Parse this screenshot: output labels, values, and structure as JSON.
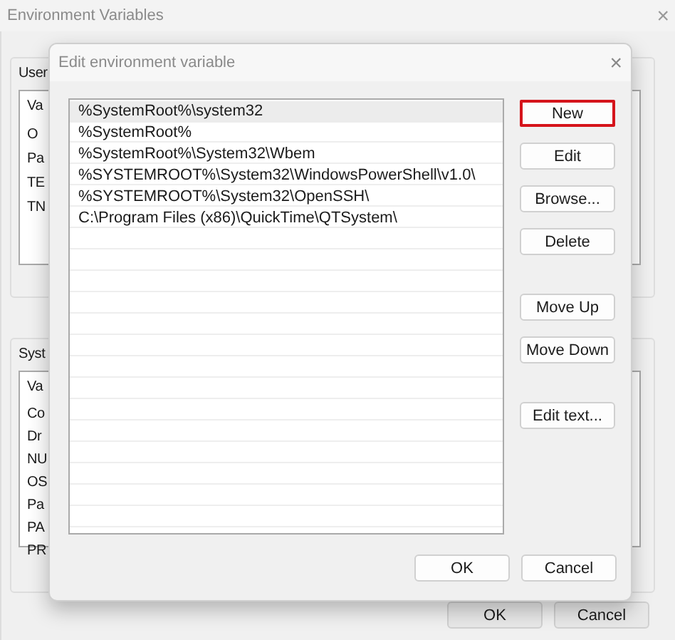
{
  "window": {
    "title": "Environment Variables",
    "close_glyph": "×"
  },
  "user_variables": {
    "label": "User",
    "header": "Va",
    "rows": [
      "O",
      "Pa",
      "TE",
      "TN"
    ]
  },
  "system_variables": {
    "label": "Syst",
    "header": "Va",
    "rows": [
      "Co",
      "Dr",
      "NU",
      "OS",
      "Pa",
      "PA",
      "PR"
    ]
  },
  "window_buttons": [
    "OK",
    "Cancel"
  ],
  "dialog": {
    "title": "Edit environment variable",
    "close_glyph": "×",
    "entries": [
      {
        "text": "%SystemRoot%\\system32",
        "selected": true
      },
      {
        "text": "%SystemRoot%",
        "selected": false
      },
      {
        "text": "%SystemRoot%\\System32\\Wbem",
        "selected": false
      },
      {
        "text": "%SYSTEMROOT%\\System32\\WindowsPowerShell\\v1.0\\",
        "selected": false
      },
      {
        "text": "%SYSTEMROOT%\\System32\\OpenSSH\\",
        "selected": false
      },
      {
        "text": "C:\\Program Files (x86)\\QuickTime\\QTSystem\\",
        "selected": false
      }
    ],
    "side_button_groups": [
      [
        {
          "label": "New",
          "highlighted": true
        },
        {
          "label": "Edit",
          "highlighted": false
        },
        {
          "label": "Browse...",
          "highlighted": false
        },
        {
          "label": "Delete",
          "highlighted": false
        }
      ],
      [
        {
          "label": "Move Up",
          "highlighted": false
        },
        {
          "label": "Move Down",
          "highlighted": false
        }
      ],
      [
        {
          "label": "Edit text...",
          "highlighted": false
        }
      ]
    ],
    "footer_buttons": [
      "OK",
      "Cancel"
    ]
  }
}
